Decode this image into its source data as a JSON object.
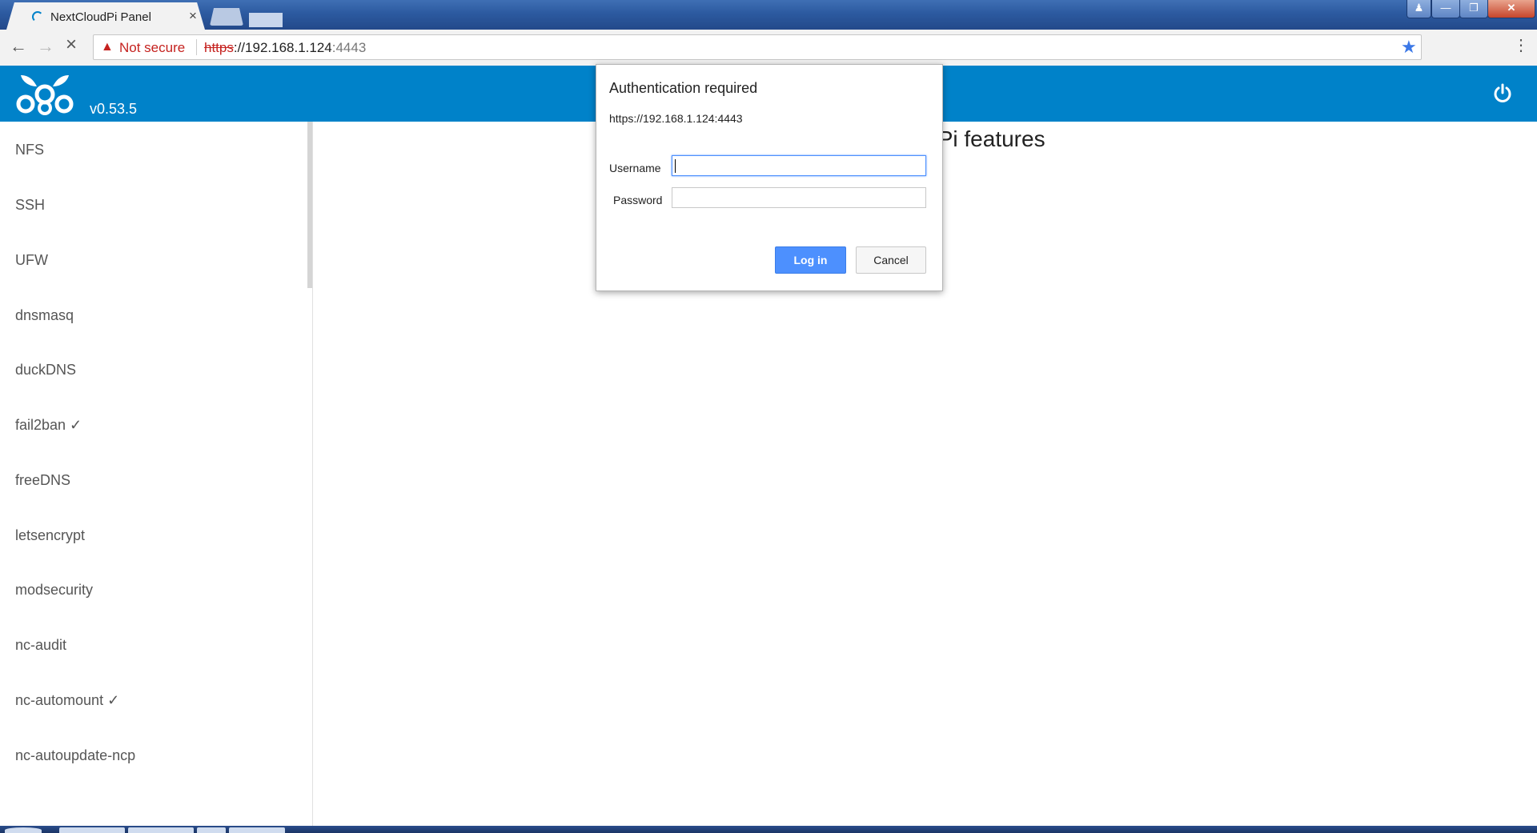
{
  "browser": {
    "tab_title": "NextCloudPi Panel",
    "tab_close": "×",
    "security_label": "Not secure",
    "url_scheme": "https",
    "url_sep": "://",
    "url_host": "192.168.1.124",
    "url_port": ":4443"
  },
  "header": {
    "version": "v0.53.5"
  },
  "sidebar": {
    "items": [
      "NFS",
      "SSH",
      "UFW",
      "dnsmasq",
      "duckDNS",
      "fail2ban ✓",
      "freeDNS",
      "letsencrypt",
      "modsecurity",
      "nc-audit",
      "nc-automount ✓",
      "nc-autoupdate-ncp"
    ]
  },
  "main": {
    "heading_visible": "oudPi features"
  },
  "dialog": {
    "title": "Authentication required",
    "origin": "https://192.168.1.124:4443",
    "username_label": "Username",
    "password_label": "Password",
    "username_value": "",
    "password_value": "",
    "login_label": "Log in",
    "cancel_label": "Cancel"
  },
  "colors": {
    "header_bg": "#0082c9",
    "insecure_red": "#c5221f",
    "login_blue": "#4d90fe"
  }
}
